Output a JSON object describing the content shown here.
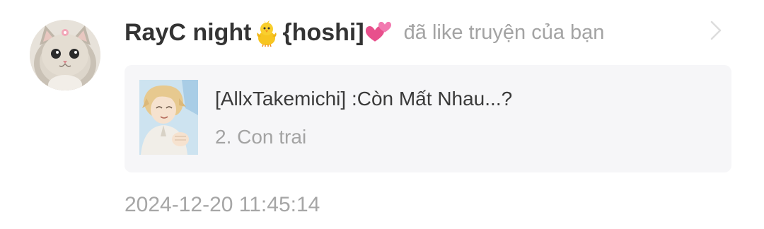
{
  "notification": {
    "avatar_icon": "cat-avatar",
    "user": {
      "name_part1": "RayC night",
      "emoji1": "baby-chick",
      "name_part2": "{hoshi]",
      "emoji2": "two-hearts"
    },
    "action": "đã like truyện của bạn",
    "chevron_icon": "chevron-right-icon",
    "story": {
      "title": "[AllxTakemichi] :Còn Mất Nhau...?",
      "chapter": "2. Con trai",
      "cover_icon": "story-cover-image"
    },
    "timestamp": "2024-12-20 11:45:14"
  },
  "colors": {
    "name": "#333333",
    "secondary_text": "#a3a3a3",
    "card_background": "#f6f6f8",
    "chevron": "#dddddd",
    "heart": "#e8508c"
  }
}
